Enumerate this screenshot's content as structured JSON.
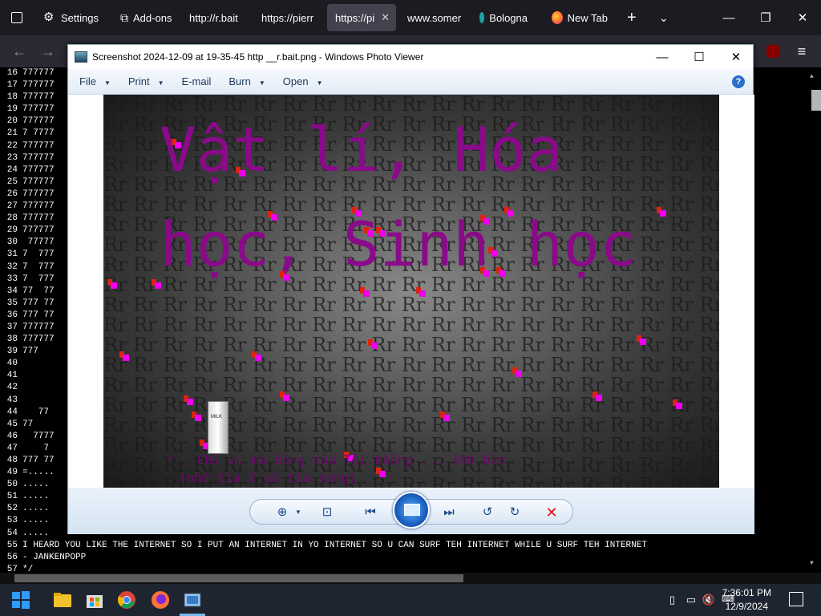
{
  "browser": {
    "tabs": [
      {
        "label": "Settings"
      },
      {
        "label": "Add-ons"
      },
      {
        "label": "http://r.bait"
      },
      {
        "label": "https://pierr"
      },
      {
        "label": "https://pi"
      },
      {
        "label": "www.somer"
      },
      {
        "label": "Bologna"
      },
      {
        "label": "New Tab"
      }
    ]
  },
  "code_lines": [
    {
      "num": "16",
      "text": "777777"
    },
    {
      "num": "17",
      "text": "777777"
    },
    {
      "num": "18",
      "text": "777777"
    },
    {
      "num": "19",
      "text": "777777"
    },
    {
      "num": "20",
      "text": "777777"
    },
    {
      "num": "21",
      "text": "7 7777"
    },
    {
      "num": "22",
      "text": "777777"
    },
    {
      "num": "23",
      "text": "777777"
    },
    {
      "num": "24",
      "text": "777777"
    },
    {
      "num": "25",
      "text": "777777"
    },
    {
      "num": "26",
      "text": "777777"
    },
    {
      "num": "27",
      "text": "777777"
    },
    {
      "num": "28",
      "text": "777777"
    },
    {
      "num": "29",
      "text": "777777"
    },
    {
      "num": "30",
      "text": " 77777"
    },
    {
      "num": "31",
      "text": "7  777"
    },
    {
      "num": "32",
      "text": "7  777"
    },
    {
      "num": "33",
      "text": "7  777"
    },
    {
      "num": "34",
      "text": "77  77"
    },
    {
      "num": "35",
      "text": "777 77"
    },
    {
      "num": "36",
      "text": "777 77"
    },
    {
      "num": "37",
      "text": "777777"
    },
    {
      "num": "38",
      "text": "777777"
    },
    {
      "num": "39",
      "text": "777"
    },
    {
      "num": "40",
      "text": ""
    },
    {
      "num": "41",
      "text": ""
    },
    {
      "num": "42",
      "text": ""
    },
    {
      "num": "43",
      "text": ""
    },
    {
      "num": "44",
      "text": "   77"
    },
    {
      "num": "45",
      "text": "77"
    },
    {
      "num": "46",
      "text": "  7777"
    },
    {
      "num": "47",
      "text": "    7"
    },
    {
      "num": "48",
      "text": "777 77"
    },
    {
      "num": "49",
      "text": "=....."
    },
    {
      "num": "50",
      "text": "....."
    },
    {
      "num": "51",
      "text": "....."
    },
    {
      "num": "52",
      "text": "....."
    },
    {
      "num": "53",
      "text": "....."
    },
    {
      "num": "54",
      "text": "....."
    },
    {
      "num": "55",
      "text": "I HEARD YOU LIKE THE INTERNET SO I PUT AN INTERNET IN YO INTERNET SO U CAN SURF TEH INTERNET WHILE U SURF TEH INTERNET"
    },
    {
      "num": "56",
      "text": "- JANKENPOPP"
    },
    {
      "num": "57",
      "text": "*/"
    }
  ],
  "viewer": {
    "title": "Screenshot 2024-12-09 at 19-35-45 http __r.bait.png - Windows Photo Viewer",
    "menu": [
      {
        "label": "File",
        "has_arrow": true
      },
      {
        "label": "Print",
        "has_arrow": true
      },
      {
        "label": "E-mail",
        "has_arrow": false
      },
      {
        "label": "Burn",
        "has_arrow": true
      },
      {
        "label": "Open",
        "has_arrow": true
      }
    ],
    "help_label": "?",
    "photo": {
      "heading": "Vật lí, Hóa học, Sinh học",
      "caption_line1": "* , Chữ vi mà bóng của Tôi không ... 100 bức",
      "caption_line2": "(nhờ tia X và tia sáng)",
      "milk_label": "MILK"
    }
  },
  "taskbar": {
    "time": "7:36:01 PM",
    "date": "12/9/2024"
  },
  "colors": {
    "heading": "#8a0a8a",
    "accent": "#2a6fc9"
  }
}
